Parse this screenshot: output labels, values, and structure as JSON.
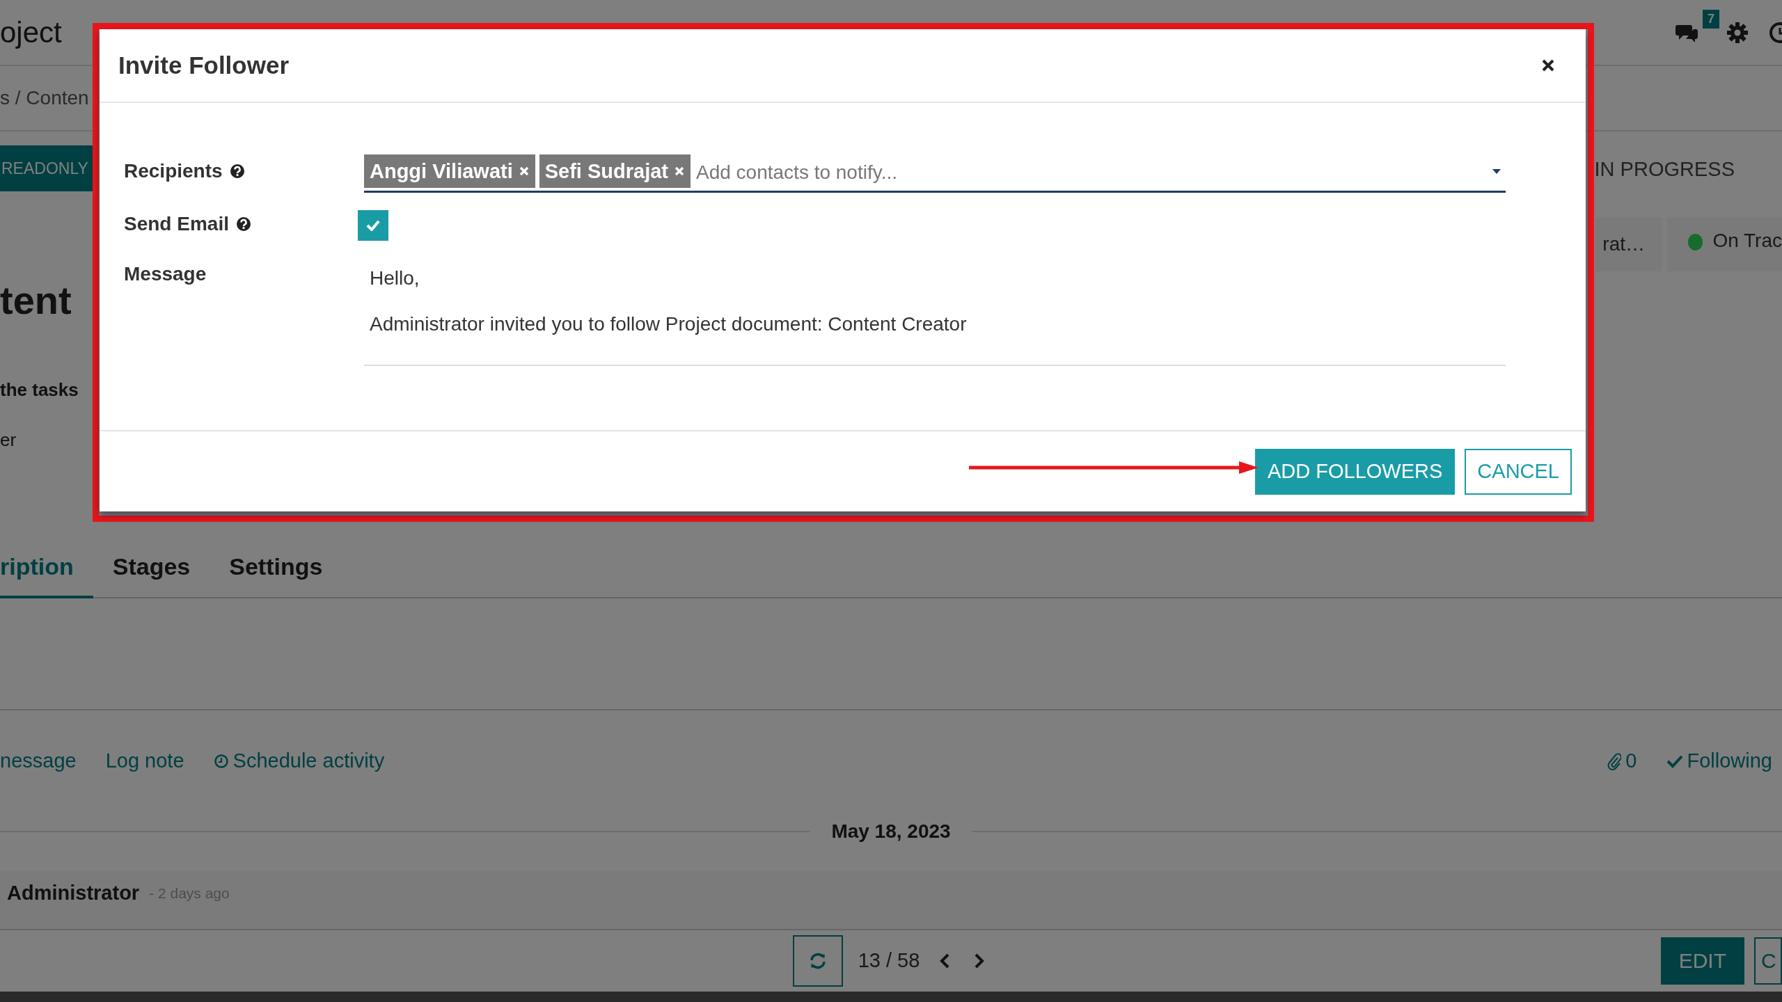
{
  "app": {
    "title": "oject",
    "notifications": "7"
  },
  "breadcrumb": "s / Conten",
  "status_bar": {
    "button": "READONLY",
    "stages": [
      {
        "label": "IN PROGRESS"
      }
    ]
  },
  "record": {
    "stat": "rat…",
    "status": {
      "label": "On Trac",
      "color": "#176b2c"
    },
    "title": "tent",
    "lines": [
      {
        "text": "the tasks",
        "bold": true
      },
      {
        "text": "er",
        "bold": false
      }
    ]
  },
  "tabs": [
    {
      "label": "ription",
      "selected": true
    },
    {
      "label": "Stages",
      "selected": false
    },
    {
      "label": "Settings",
      "selected": false
    }
  ],
  "chatter": {
    "actions": [
      {
        "label": "nessage",
        "icon": false
      },
      {
        "label": "Log note",
        "icon": false
      },
      {
        "label": "Schedule activity",
        "icon": true
      }
    ],
    "attachments": "0",
    "follow": "Following",
    "date": "May 18, 2023",
    "message": {
      "author": "Administrator",
      "time": "- 2 days ago"
    }
  },
  "pager": "13 / 58",
  "form_buttons": [
    {
      "label": "EDIT",
      "primary": true
    },
    {
      "label": "C",
      "primary": false
    }
  ],
  "dialog": {
    "title": "Invite Follower",
    "fields": [
      {
        "kind": "tags",
        "label": "Recipients",
        "help": true,
        "tags": [
          "Anggi Viliawati",
          "Sefi Sudrajat"
        ],
        "placeholder": "Add contacts to notify..."
      },
      {
        "kind": "checkbox",
        "label": "Send Email",
        "help": true,
        "checked": true
      },
      {
        "kind": "message",
        "label": "Message",
        "help": false,
        "paragraphs": [
          "Hello,",
          "Administrator invited you to follow Project document: Content Creator"
        ]
      }
    ],
    "buttons": [
      {
        "label": "ADD FOLLOWERS",
        "primary": true
      },
      {
        "label": "CANCEL",
        "primary": false
      }
    ]
  },
  "annotations": {
    "highlight_frame": true,
    "pointer_arrow": true
  }
}
